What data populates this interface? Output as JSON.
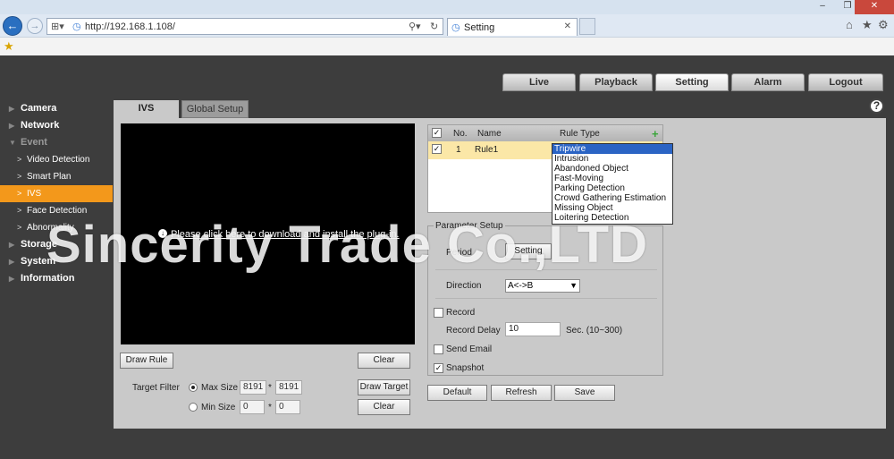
{
  "browser": {
    "url": "http://192.168.1.108/",
    "tab_title": "Setting"
  },
  "main_tabs": [
    {
      "label": "Live"
    },
    {
      "label": "Playback"
    },
    {
      "label": "Setting"
    },
    {
      "label": "Alarm"
    },
    {
      "label": "Logout"
    }
  ],
  "sidebar": {
    "items": [
      {
        "label": "Camera"
      },
      {
        "label": "Network"
      },
      {
        "label": "Event"
      },
      {
        "label": "Video Detection"
      },
      {
        "label": "Smart Plan"
      },
      {
        "label": "IVS"
      },
      {
        "label": "Face Detection"
      },
      {
        "label": "Abnormality"
      },
      {
        "label": "Storage"
      },
      {
        "label": "System"
      },
      {
        "label": "Information"
      }
    ]
  },
  "panel_tabs": {
    "ivs": "IVS",
    "global": "Global Setup"
  },
  "video": {
    "plugin_text": "Please click here to download and install the plug-in."
  },
  "left_buttons": {
    "draw_rule": "Draw Rule",
    "clear1": "Clear",
    "draw_target": "Draw Target",
    "clear2": "Clear"
  },
  "target_filter": {
    "label": "Target Filter",
    "max_size_label": "Max Size",
    "max_w": "8191",
    "max_h": "8191",
    "min_size_label": "Min Size",
    "min_w": "0",
    "min_h": "0",
    "times": "*"
  },
  "rule_table": {
    "headers": {
      "no": "No.",
      "name": "Name",
      "type": "Rule Type"
    },
    "rows": [
      {
        "no": "1",
        "name": "Rule1"
      }
    ]
  },
  "rule_type_dropdown": {
    "options": [
      "Tripwire",
      "Intrusion",
      "Abandoned Object",
      "Fast-Moving",
      "Parking Detection",
      "Crowd Gathering Estimation",
      "Missing Object",
      "Loitering Detection"
    ],
    "selected": "Tripwire"
  },
  "params": {
    "title": "Parameter Setup",
    "period_label": "Period",
    "setting_button": "Setting",
    "direction_label": "Direction",
    "direction_value": "A<->B",
    "record_label": "Record",
    "record_delay_label": "Record Delay",
    "record_delay_value": "10",
    "record_delay_unit": "Sec. (10~300)",
    "send_email_label": "Send Email",
    "snapshot_label": "Snapshot"
  },
  "bottom_buttons": {
    "default": "Default",
    "refresh": "Refresh",
    "save": "Save"
  },
  "watermark": "Sincerity Trade Co.,LTD"
}
